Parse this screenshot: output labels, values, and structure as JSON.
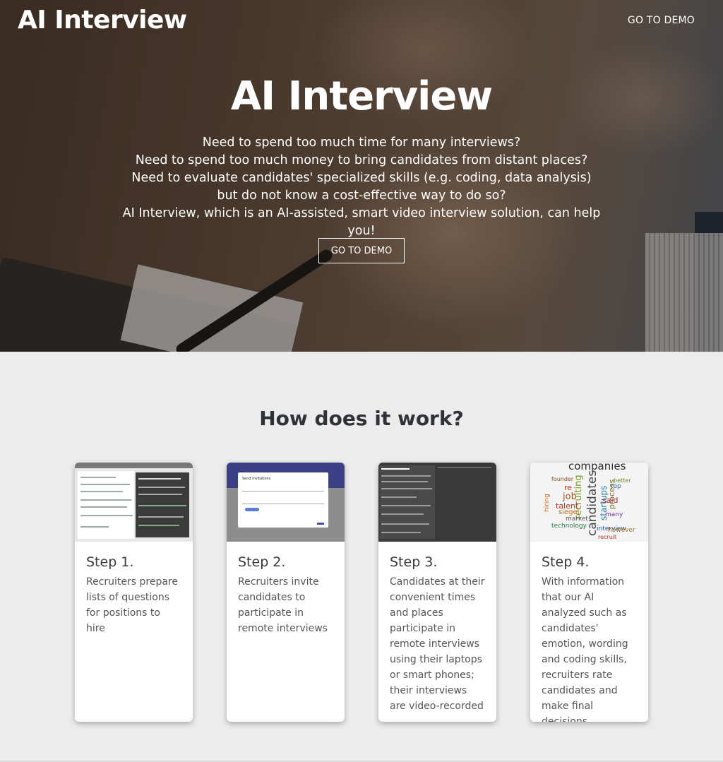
{
  "header": {
    "logo": "AI Interview",
    "nav_demo": "GO TO DEMO"
  },
  "hero": {
    "title": "AI Interview",
    "lines": [
      "Need to spend too much time for many interviews?",
      "Need to spend too much money to bring candidates from distant places?",
      "Need to evaluate candidates' specialized skills (e.g. coding, data analysis) but do not know a cost-effective way to do so?",
      "AI Interview, which is an AI-assisted, smart video interview solution, can help you!"
    ],
    "button": "GO TO DEMO"
  },
  "how": {
    "title": "How does it work?",
    "steps": [
      {
        "title": "Step 1.",
        "desc": "Recruiters prepare lists of questions for positions to hire"
      },
      {
        "title": "Step 2.",
        "desc": "Recruiters invite candidates to participate in remote interviews"
      },
      {
        "title": "Step 3.",
        "desc": "Candidates at their convenient times and places participate in remote interviews using their laptops or smart phones; their interviews are video-recorded"
      },
      {
        "title": "Step 4.",
        "desc": "With information that our AI analyzed such as candidates' emotion, wording and coding skills, recruiters rate candidates and make final decisions."
      }
    ],
    "thumbs": {
      "step1": {
        "heading": "Hiring Java from ..."
      },
      "step2": {
        "dialog_title": "Send invitations"
      },
      "step3": {
        "heading": "Hiring Java from ..."
      },
      "step4": {
        "words": [
          "companies",
          "candidates",
          "recruiting",
          "startups",
          "process",
          "job",
          "re",
          "talent",
          "siegel",
          "market",
          "said",
          "interview",
          "technology",
          "many",
          "hiring",
          "top",
          "however",
          "recruit",
          "founder",
          "better"
        ]
      }
    }
  },
  "colors": {
    "page_bg": "#ececec",
    "card_bg": "#ffffff",
    "hero_text": "#ffffff"
  }
}
